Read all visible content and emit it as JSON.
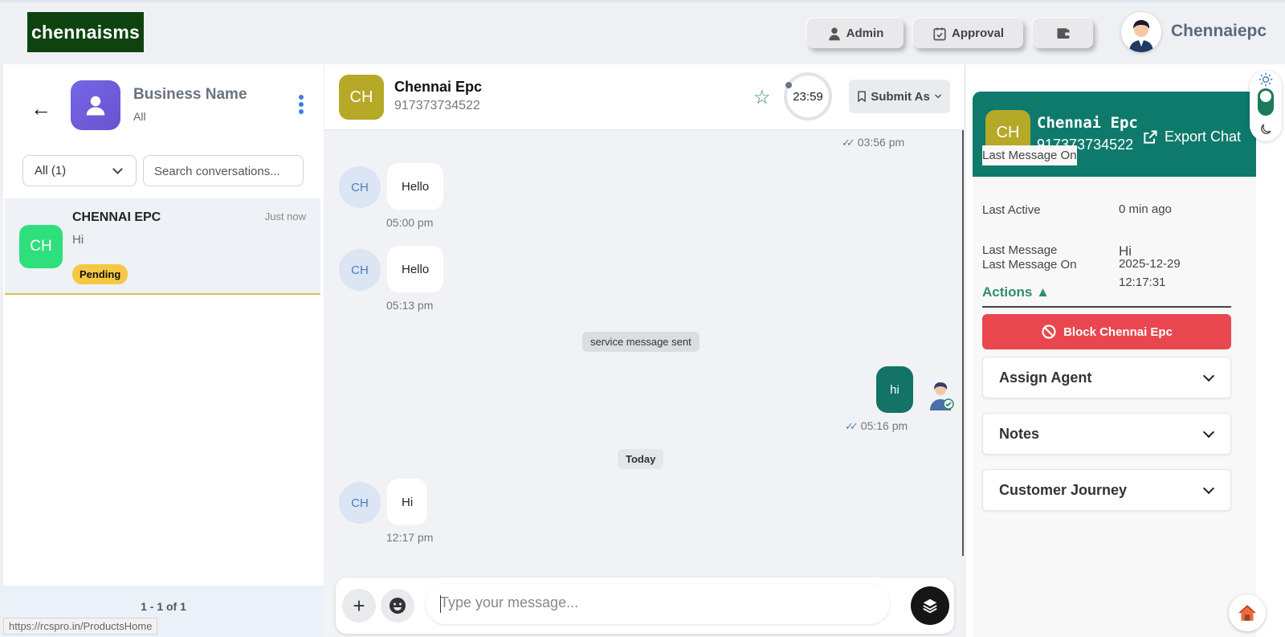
{
  "header": {
    "logo_text": "chennaisms",
    "buttons": [
      {
        "label": "Admin",
        "icon": "user-tie-icon"
      },
      {
        "label": "Approval",
        "icon": "calendar-check-icon"
      },
      {
        "label": "",
        "icon": "wallet-icon"
      }
    ],
    "user_name": "Chennaiepc"
  },
  "sidebar": {
    "business_name": "Business Name",
    "business_sub": "All",
    "filter_value": "All (1)",
    "search_placeholder": "Search conversations...",
    "conversations": [
      {
        "initials": "CH",
        "name": "CHENNAI EPC",
        "time": "Just now",
        "last": "Hi",
        "badge": "Pending"
      }
    ],
    "pagination": "1 - 1 of 1",
    "status_url": "https://rcspro.in/ProductsHome"
  },
  "chat": {
    "initials": "CH",
    "name": "Chennai Epc",
    "phone": "917373734522",
    "timer": "23:59",
    "submit_label": "Submit As",
    "top_time": "03:56 pm",
    "messages": [
      {
        "text": "Hello",
        "time": "05:00 pm"
      },
      {
        "text": "Hello",
        "time": "05:13 pm"
      },
      {
        "system": "service message sent"
      },
      {
        "text": "hi",
        "time": "05:16 pm"
      },
      {
        "divider": "Today"
      },
      {
        "text": "Hi",
        "time": "12:17 pm"
      }
    ],
    "input_placeholder": "Type your message..."
  },
  "details": {
    "initials": "CH",
    "name": "Chennai Epc",
    "phone": "917373734522",
    "export_label": "Export Chat",
    "last_message_on_label": "Last Message On",
    "last_message_on_date": "2025-12-29",
    "last_message_on_time": "12:17:31",
    "last_active_label": "Last Active",
    "last_active_value": "0 min ago",
    "last_message_label": "Last Message",
    "last_message_value": "Hi",
    "actions_label": "Actions",
    "block_label": "Block Chennai Epc",
    "accordions": [
      "Assign Agent",
      "Notes",
      "Customer Journey"
    ]
  },
  "colors": {
    "accent": "#0e7a6c",
    "danger": "#e8474f",
    "badge": "#f5c842",
    "online": "#2ee07b"
  }
}
